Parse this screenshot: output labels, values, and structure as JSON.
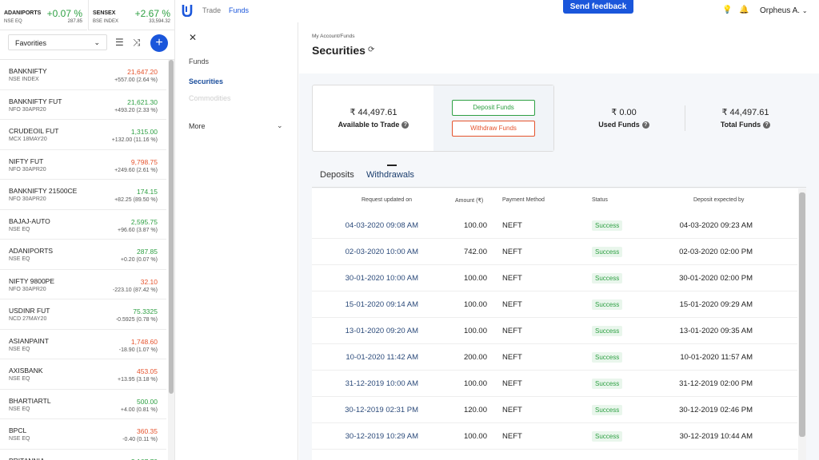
{
  "indices": [
    {
      "name": "ADANIPORTS",
      "sub": "NSE EQ",
      "change": "+0.07 %",
      "price": "287.85"
    },
    {
      "name": "SENSEX",
      "sub": "BSE INDEX",
      "change": "+2.67 %",
      "price": "33,594.32"
    }
  ],
  "watchlist": {
    "selector": "Favorities",
    "items": [
      {
        "symbol": "BANKNIFTY",
        "exchange": "NSE INDEX",
        "price": "21,647.20",
        "change": "+557.00 (2.64 %)",
        "dir": "dn"
      },
      {
        "symbol": "BANKNIFTY FUT",
        "exchange": "NFO 30APR20",
        "price": "21,621.30",
        "change": "+493.20 (2.33 %)",
        "dir": "up"
      },
      {
        "symbol": "CRUDEOIL FUT",
        "exchange": "MCX 18MAY20",
        "price": "1,315.00",
        "change": "+132.00 (11.16 %)",
        "dir": "up"
      },
      {
        "symbol": "NIFTY FUT",
        "exchange": "NFO 30APR20",
        "price": "9,798.75",
        "change": "+249.60 (2.61 %)",
        "dir": "dn"
      },
      {
        "symbol": "BANKNIFTY 21500CE",
        "exchange": "NFO 30APR20",
        "price": "174.15",
        "change": "+82.25 (89.50 %)",
        "dir": "up"
      },
      {
        "symbol": "BAJAJ-AUTO",
        "exchange": "NSE EQ",
        "price": "2,595.75",
        "change": "+96.60 (3.87 %)",
        "dir": "up"
      },
      {
        "symbol": "ADANIPORTS",
        "exchange": "NSE EQ",
        "price": "287.85",
        "change": "+0.20 (0.07 %)",
        "dir": "up"
      },
      {
        "symbol": "NIFTY 9800PE",
        "exchange": "NFO 30APR20",
        "price": "32.10",
        "change": "-223.10 (87.42 %)",
        "dir": "dn"
      },
      {
        "symbol": "USDINR FUT",
        "exchange": "NCD 27MAY20",
        "price": "75.3325",
        "change": "-0.5925 (0.78 %)",
        "dir": "up"
      },
      {
        "symbol": "ASIANPAINT",
        "exchange": "NSE EQ",
        "price": "1,748.60",
        "change": "-18.90 (1.07 %)",
        "dir": "dn"
      },
      {
        "symbol": "AXISBANK",
        "exchange": "NSE EQ",
        "price": "453.05",
        "change": "+13.95 (3.18 %)",
        "dir": "dn"
      },
      {
        "symbol": "BHARTIARTL",
        "exchange": "NSE EQ",
        "price": "500.00",
        "change": "+4.00 (0.81 %)",
        "dir": "up"
      },
      {
        "symbol": "BPCL",
        "exchange": "NSE EQ",
        "price": "360.35",
        "change": "-0.40 (0.11 %)",
        "dir": "dn"
      },
      {
        "symbol": "BRITANNIA",
        "exchange": "",
        "price": "3,167.70",
        "change": "",
        "dir": "up"
      }
    ]
  },
  "topbar": {
    "nav_trade": "Trade",
    "nav_funds": "Funds",
    "feedback": "Send feedback",
    "user": "Orpheus A."
  },
  "menu": {
    "funds": "Funds",
    "securities": "Securities",
    "commodities": "Commodities",
    "more": "More"
  },
  "page": {
    "breadcrumb": "My Account/Funds",
    "title": "Securities"
  },
  "summary": {
    "available_amount": "₹ 44,497.61",
    "available_label": "Available to Trade",
    "deposit_btn": "Deposit Funds",
    "withdraw_btn": "Withdraw Funds",
    "used_amount": "₹ 0.00",
    "used_label": "Used Funds",
    "total_amount": "₹ 44,497.61",
    "total_label": "Total Funds"
  },
  "tabs": {
    "deposits": "Deposits",
    "withdrawals": "Withdrawals"
  },
  "table": {
    "headers": {
      "requested": "Request updated on",
      "amount": "Amount (₹)",
      "method": "Payment Method",
      "status": "Status",
      "expected": "Deposit expected by"
    },
    "rows": [
      {
        "requested": "04-03-2020 09:08 AM",
        "amount": "100.00",
        "method": "NEFT",
        "status": "Success",
        "expected": "04-03-2020 09:23 AM"
      },
      {
        "requested": "02-03-2020 10:00 AM",
        "amount": "742.00",
        "method": "NEFT",
        "status": "Success",
        "expected": "02-03-2020 02:00 PM"
      },
      {
        "requested": "30-01-2020 10:00 AM",
        "amount": "100.00",
        "method": "NEFT",
        "status": "Success",
        "expected": "30-01-2020 02:00 PM"
      },
      {
        "requested": "15-01-2020 09:14 AM",
        "amount": "100.00",
        "method": "NEFT",
        "status": "Success",
        "expected": "15-01-2020 09:29 AM"
      },
      {
        "requested": "13-01-2020 09:20 AM",
        "amount": "100.00",
        "method": "NEFT",
        "status": "Success",
        "expected": "13-01-2020 09:35 AM"
      },
      {
        "requested": "10-01-2020 11:42 AM",
        "amount": "200.00",
        "method": "NEFT",
        "status": "Success",
        "expected": "10-01-2020 11:57 AM"
      },
      {
        "requested": "31-12-2019 10:00 AM",
        "amount": "100.00",
        "method": "NEFT",
        "status": "Success",
        "expected": "31-12-2019 02:00 PM"
      },
      {
        "requested": "30-12-2019 02:31 PM",
        "amount": "120.00",
        "method": "NEFT",
        "status": "Success",
        "expected": "30-12-2019 02:46 PM"
      },
      {
        "requested": "30-12-2019 10:29 AM",
        "amount": "100.00",
        "method": "NEFT",
        "status": "Success",
        "expected": "30-12-2019 10:44 AM"
      }
    ]
  }
}
